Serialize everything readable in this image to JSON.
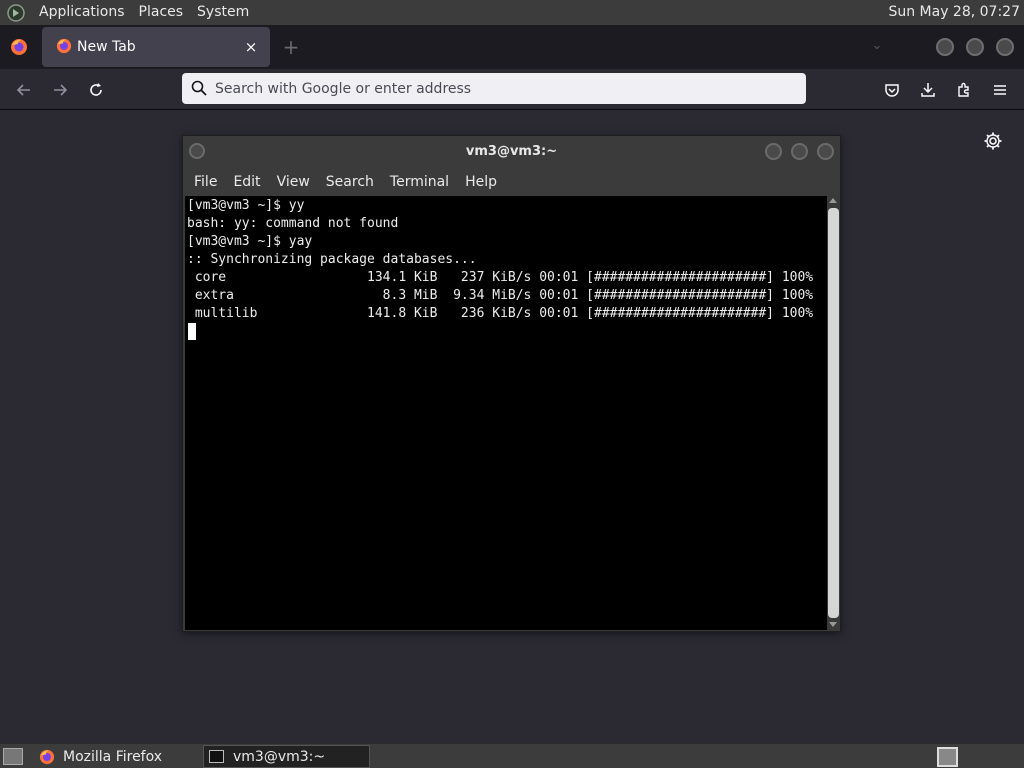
{
  "system_panel": {
    "menus": [
      "Applications",
      "Places",
      "System"
    ],
    "clock": "Sun May 28, 07:27"
  },
  "browser": {
    "tab": {
      "title": "New Tab",
      "close": "×"
    },
    "new_tab": "+",
    "url_placeholder": "Search with Google or enter address"
  },
  "terminal": {
    "title": "vm3@vm3:~",
    "menu": [
      "File",
      "Edit",
      "View",
      "Search",
      "Terminal",
      "Help"
    ],
    "lines": [
      "[vm3@vm3 ~]$ yy",
      "bash: yy: command not found",
      "[vm3@vm3 ~]$ yay",
      ":: Synchronizing package databases...",
      " core                  134.1 KiB   237 KiB/s 00:01 [######################] 100%",
      " extra                   8.3 MiB  9.34 MiB/s 00:01 [######################] 100%",
      " multilib              141.8 KiB   236 KiB/s 00:01 [######################] 100%"
    ]
  },
  "taskbar": {
    "items": [
      "Mozilla Firefox",
      "vm3@vm3:~"
    ]
  }
}
